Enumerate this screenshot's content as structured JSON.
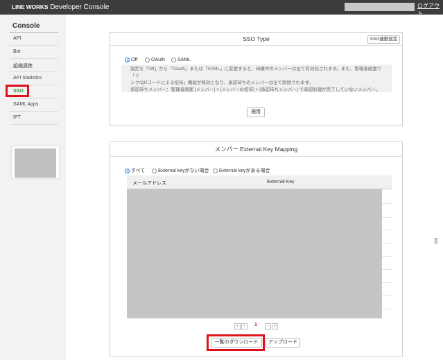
{
  "header": {
    "brand_main": "LINE WORKS",
    "brand_sub": "Developer Console",
    "logout": "ログアウト"
  },
  "sidebar": {
    "title": "Console",
    "items": [
      {
        "label": "API"
      },
      {
        "label": "Bot"
      },
      {
        "label": "組織連携"
      },
      {
        "label": "API Statistics"
      },
      {
        "label": "SSO"
      },
      {
        "label": "SAML Apps"
      },
      {
        "label": "IPT"
      }
    ]
  },
  "sso_panel": {
    "title": "SSO Type",
    "settings_button": "SSO連動設定",
    "options": [
      "Off",
      "OAuth",
      "SAML"
    ],
    "selected": "Off",
    "info_line1": "設定を「Off」から「OAuth」または「SAML」に変更すると、待機中のメンバーは全て有効化されます。また、管理者画面で「リ",
    "info_line2": "ンク/QRコードによる招待」機能が無効になり、承認待ちのメンバーは全て削除されます。",
    "info_line3": "承認待ちメンバー：管理者画面 [メンバー] > [メンバーの招待] > [承認待ちメンバー] で承認処理が完了していないメンバー。",
    "apply_button": "適用"
  },
  "mapping_panel": {
    "title": "メンバー External Key Mapping",
    "filters": [
      "すべて",
      "External keyがない場合",
      "External keyがある場合"
    ],
    "selected_filter": "すべて",
    "columns": [
      "メールアドレス",
      "External Key"
    ],
    "pagination": {
      "first": "«",
      "prev": "‹",
      "current": "1",
      "next": "›",
      "last": "»"
    },
    "download_button": "一覧のダウンロード",
    "upload_button": "アップロード"
  }
}
